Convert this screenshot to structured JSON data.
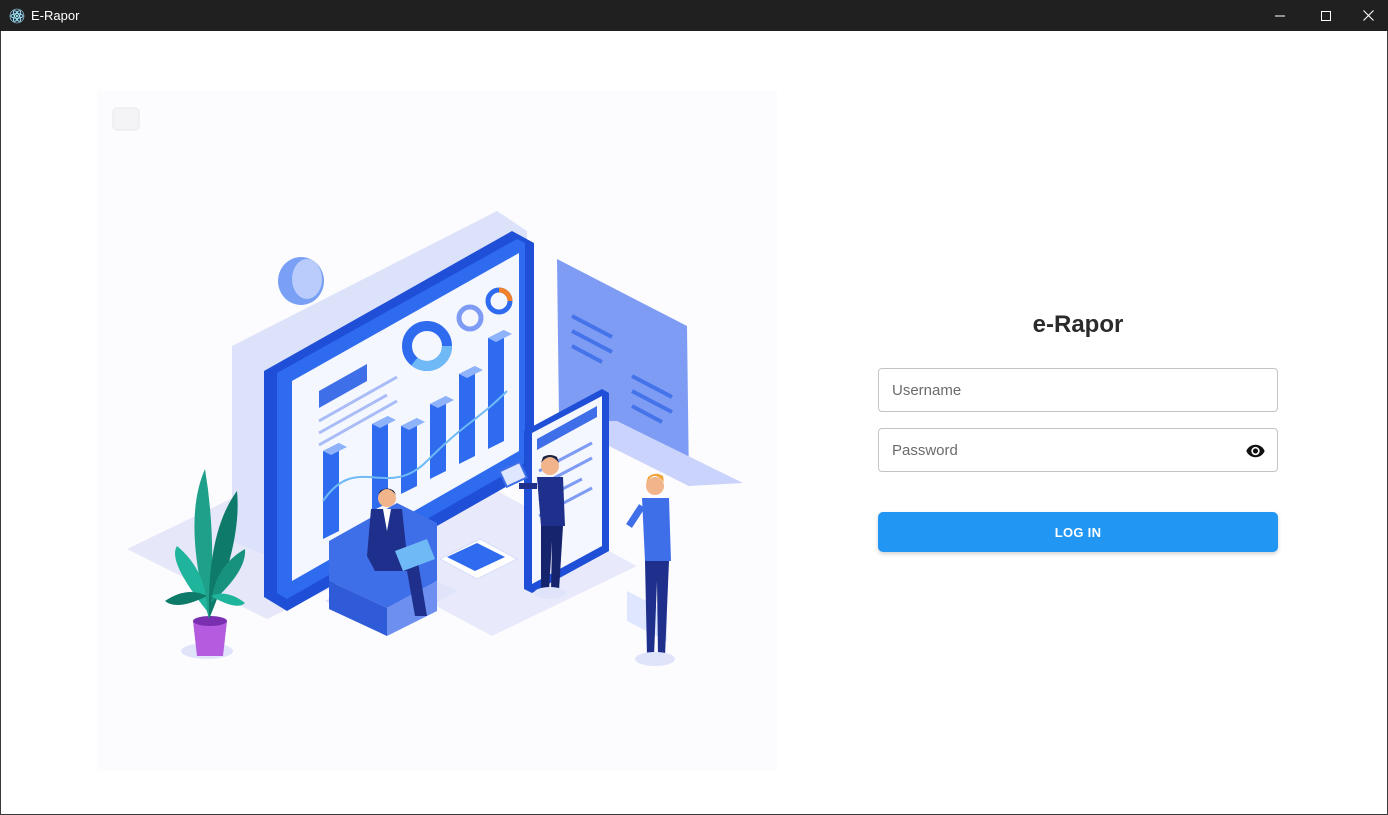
{
  "window": {
    "title": "E-Rapor",
    "icon": "electron-app-icon",
    "controls": [
      "minimize-icon",
      "maximize-icon",
      "close-icon"
    ]
  },
  "login": {
    "title": "e-Rapor",
    "username_placeholder": "Username",
    "password_placeholder": "Password",
    "password_toggle_icon": "eye-icon",
    "submit_label": "LOG IN"
  },
  "illustration": {
    "subject": "isometric-dashboard-illustration"
  },
  "colors": {
    "accent": "#2196f3",
    "titlebar": "#202020",
    "illustration_blue": "#3f6fe8",
    "illustration_dark": "#1e2f8c",
    "plant_green": "#1fa08a",
    "pot_purple": "#b45be0"
  }
}
